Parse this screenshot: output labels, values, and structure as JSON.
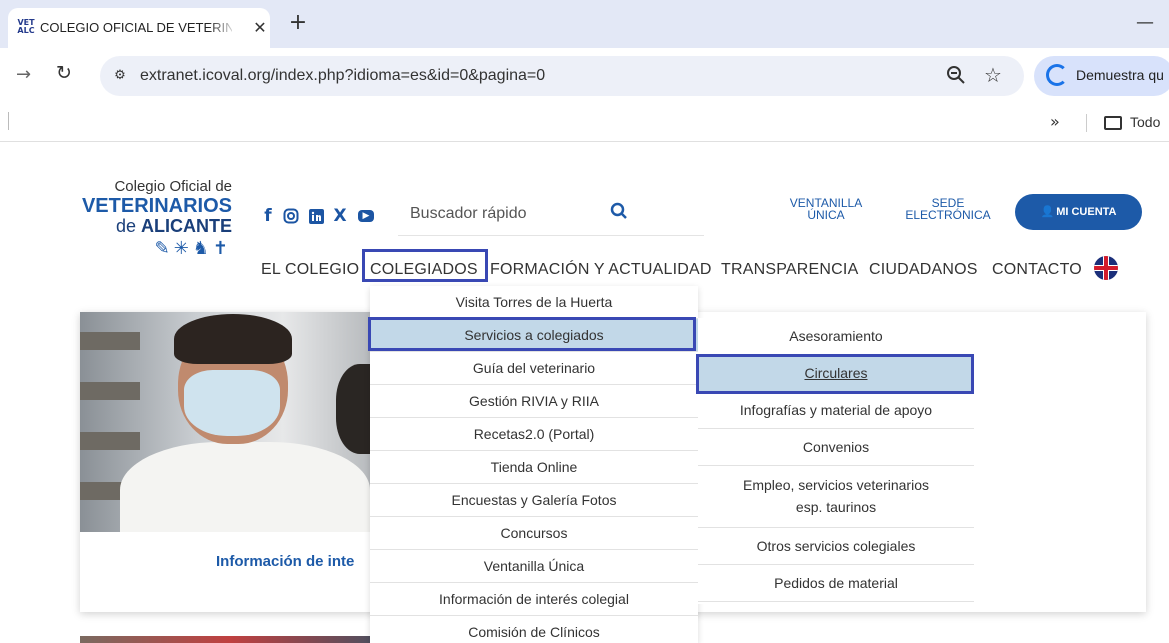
{
  "browser": {
    "tab": {
      "favicon_text": "VET ALC",
      "title": "COLEGIO OFICIAL DE VETERINA"
    },
    "url": "extranet.icoval.org/index.php?idioma=es&id=0&pagina=0",
    "profile_label": "Demuestra qu",
    "bookmarks": {
      "folder_label": "Todo"
    },
    "icons": {
      "favicon": "vet-alc-favicon",
      "close": "close-icon",
      "new_tab": "plus-icon",
      "minimize": "minimize-icon",
      "forward": "arrow-forward-icon",
      "reload": "reload-icon",
      "site_info": "tune-icon",
      "zoom": "zoom-icon",
      "star": "star-icon",
      "profile": "loading-ring-icon",
      "chevron": "double-chevron-icon",
      "folder": "folder-icon"
    }
  },
  "site": {
    "logo": {
      "line1": "Colegio Oficial de",
      "line2": "VETERINARIOS",
      "line3_prefix": "de ",
      "line3_bold": "ALICANTE"
    },
    "social": [
      "facebook-icon",
      "instagram-icon",
      "linkedin-icon",
      "x-icon",
      "youtube-icon"
    ],
    "search": {
      "placeholder": "Buscador rápido",
      "icon": "search-icon"
    },
    "top_links": {
      "ventanilla": "VENTANILLA\nÚNICA",
      "sede": "SEDE\nELECTRÓNICA"
    },
    "account_button": "MI CUENTA",
    "nav": [
      "EL COLEGIO",
      "COLEGIADOS",
      "FORMACIÓN Y ACTUALIDAD",
      "TRANSPARENCIA",
      "CIUDADANOS",
      "CONTACTO"
    ],
    "language_flag": "uk-flag-icon",
    "accent_color": "#1d5aa8",
    "highlight_color": "#3948b4"
  },
  "card": {
    "caption": "Información de inte"
  },
  "dropdown": {
    "items": [
      "Visita Torres de la Huerta",
      "Servicios a colegiados",
      "Guía del veterinario",
      "Gestión RIVIA y RIIA",
      "Recetas2.0 (Portal)",
      "Tienda Online",
      "Encuestas y Galería Fotos",
      "Concursos",
      "Ventanilla Única",
      "Información de interés colegial",
      "Comisión de Clínicos"
    ],
    "active_item": "Servicios a colegiados"
  },
  "submenu": {
    "items": [
      "Asesoramiento",
      "Circulares",
      "Infografías y material de apoyo",
      "Convenios",
      "Empleo, servicios veterinarios\nesp. taurinos",
      "Otros servicios colegiales",
      "Pedidos de material"
    ],
    "active_item": "Circulares"
  }
}
